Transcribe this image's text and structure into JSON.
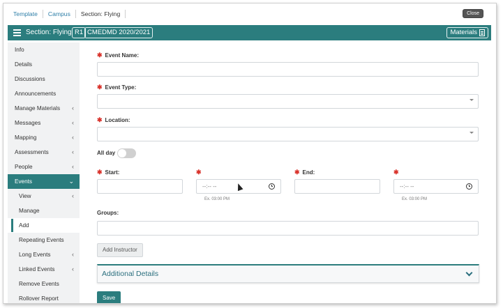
{
  "breadcrumb": [
    "Template",
    "Campus",
    "Section: Flying"
  ],
  "close_label": "Close",
  "header": {
    "title": "Section: Flying",
    "chip_r1": "R1",
    "chip_year": "CMEDMD 2020/2021",
    "materials_label": "Materials"
  },
  "sidebar": {
    "items": [
      {
        "label": "Info",
        "chevron": ""
      },
      {
        "label": "Details",
        "chevron": ""
      },
      {
        "label": "Discussions",
        "chevron": ""
      },
      {
        "label": "Announcements",
        "chevron": ""
      },
      {
        "label": "Manage Materials",
        "chevron": "‹"
      },
      {
        "label": "Messages",
        "chevron": "‹"
      },
      {
        "label": "Mapping",
        "chevron": "‹"
      },
      {
        "label": "Assessments",
        "chevron": "‹"
      },
      {
        "label": "People",
        "chevron": "‹"
      },
      {
        "label": "Events",
        "chevron": "⌄"
      },
      {
        "label": "View",
        "chevron": "‹"
      },
      {
        "label": "Manage",
        "chevron": ""
      },
      {
        "label": "Add",
        "chevron": ""
      },
      {
        "label": "Repeating Events",
        "chevron": ""
      },
      {
        "label": "Long Events",
        "chevron": "‹"
      },
      {
        "label": "Linked Events",
        "chevron": "‹"
      },
      {
        "label": "Remove Events",
        "chevron": ""
      },
      {
        "label": "Rollover Report",
        "chevron": ""
      }
    ]
  },
  "form": {
    "req_mark": "✱",
    "event_name_label": "Event Name:",
    "event_type_label": "Event Type:",
    "location_label": "Location:",
    "all_day_label": "All day",
    "start_label": "Start:",
    "end_label": "End:",
    "time_placeholder": "--:-- --",
    "time_hint": "Ex. 03:00 PM",
    "groups_label": "Groups:",
    "add_instructor_label": "Add Instructor",
    "additional_details_label": "Additional Details",
    "save_label": "Save"
  },
  "colors": {
    "accent": "#2b7d7e",
    "required": "#d9322b",
    "link": "#2f7fa8"
  }
}
